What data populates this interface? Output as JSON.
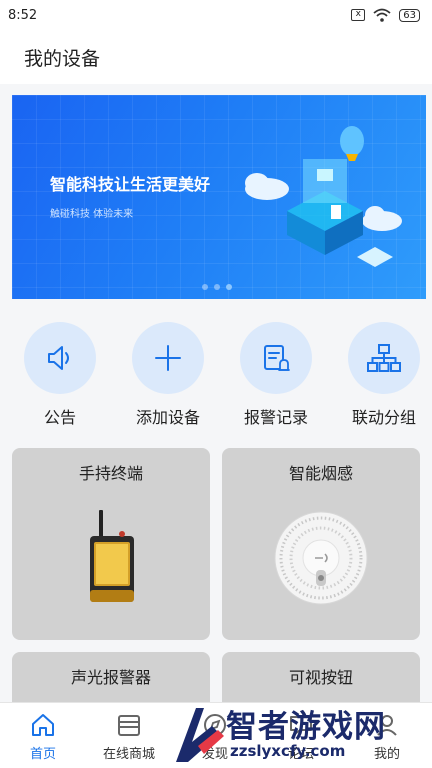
{
  "status_bar": {
    "time": "8:52",
    "sim_mark": "x",
    "battery": "63"
  },
  "header": {
    "title": "我的设备"
  },
  "banner": {
    "headline": "智能科技让生活更美好",
    "subline": "触碰科技  体验未来",
    "slide_count": 3,
    "active_slide": 3
  },
  "quick_actions": [
    {
      "label": "公告",
      "icon": "speaker-icon"
    },
    {
      "label": "添加设备",
      "icon": "plus-icon"
    },
    {
      "label": "报警记录",
      "icon": "alarm-record-icon"
    },
    {
      "label": "联动分组",
      "icon": "org-chart-icon"
    }
  ],
  "device_cards": [
    {
      "title": "手持终端",
      "image": "handheld-terminal-image"
    },
    {
      "title": "智能烟感",
      "image": "smoke-detector-image"
    },
    {
      "title": "声光报警器"
    },
    {
      "title": "可视按钮"
    }
  ],
  "tab_bar": {
    "active": "首页",
    "tabs": [
      {
        "label": "首页",
        "icon": "home-icon"
      },
      {
        "label": "在线商城",
        "icon": "store-icon"
      },
      {
        "label": "发现",
        "icon": "compass-icon"
      },
      {
        "label": "论坛",
        "icon": "forum-icon"
      },
      {
        "label": "我的",
        "icon": "user-icon"
      }
    ]
  },
  "watermark": {
    "text": "智者游戏网",
    "url": "zzslyxcfy.com"
  },
  "colors": {
    "accent": "#1a73e8",
    "quick_circle": "#dbe9fb",
    "card_bg": "#d1d1d1",
    "watermark": "#1b2a6b"
  }
}
